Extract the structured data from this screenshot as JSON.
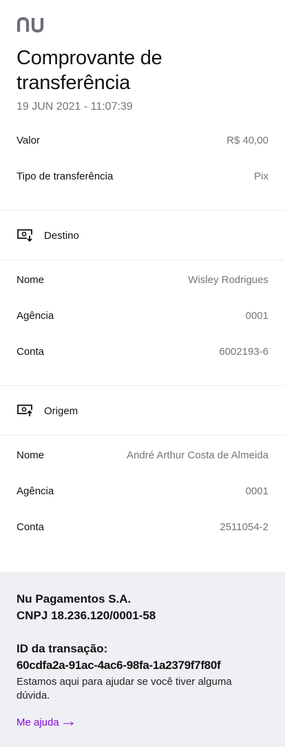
{
  "brand": {
    "logo_icon": "nubank-logo-icon",
    "color": "#820ad1"
  },
  "header": {
    "title": "Comprovante de transferência",
    "datetime": "19 JUN 2021 - 11:07:39"
  },
  "summary": [
    {
      "label": "Valor",
      "value": "R$ 40,00"
    },
    {
      "label": "Tipo de transferência",
      "value": "Pix"
    }
  ],
  "destino": {
    "title": "Destino",
    "icon": "screen-arrow-down-icon",
    "fields": [
      {
        "label": "Nome",
        "value": "Wisley Rodrigues"
      },
      {
        "label": "Agência",
        "value": "0001"
      },
      {
        "label": "Conta",
        "value": "6002193-6"
      }
    ]
  },
  "origem": {
    "title": "Origem",
    "icon": "screen-arrow-up-icon",
    "fields": [
      {
        "label": "Nome",
        "value": "André Arthur Costa de Almeida"
      },
      {
        "label": "Agência",
        "value": "0001"
      },
      {
        "label": "Conta",
        "value": "2511054-2"
      }
    ]
  },
  "footer": {
    "company_name": "Nu Pagamentos S.A.",
    "cnpj": "CNPJ 18.236.120/0001-58",
    "txid_label": "ID da transação:",
    "txid": "60cdfa2a-91ac-4ac6-98fa-1a2379f7f80f",
    "help_text": "Estamos aqui para ajudar se você tiver alguma dúvida.",
    "help_link": "Me ajuda",
    "help_link_icon": "arrow-right-icon"
  }
}
